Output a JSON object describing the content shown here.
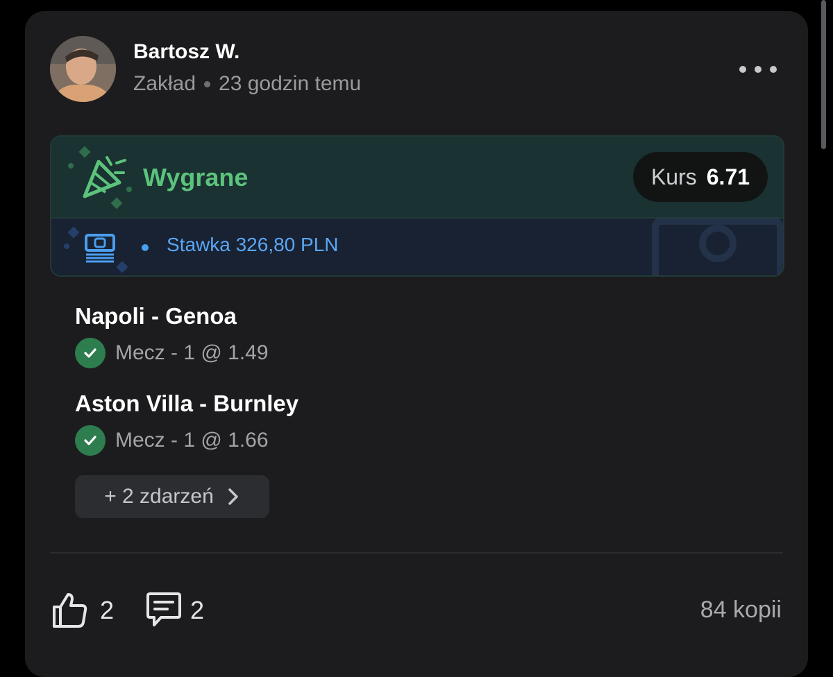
{
  "post": {
    "author": "Bartosz W.",
    "type_label": "Zakład",
    "time_ago": "23 godzin temu"
  },
  "result": {
    "status": "Wygrane",
    "odds_label": "Kurs",
    "odds_value": "6.71",
    "stake": "Stawka 326,80 PLN"
  },
  "events": [
    {
      "title": "Napoli - Genoa",
      "detail": "Mecz - 1 @ 1.49"
    },
    {
      "title": "Aston Villa - Burnley",
      "detail": "Mecz - 1 @ 1.66"
    }
  ],
  "more_events_label": "+ 2 zdarzeń",
  "footer": {
    "likes": "2",
    "comments": "2",
    "copies": "84 kopii"
  },
  "colors": {
    "win_green": "#5cc37c",
    "stake_blue": "#5aa6f4",
    "check_green": "#2e7d4e"
  }
}
